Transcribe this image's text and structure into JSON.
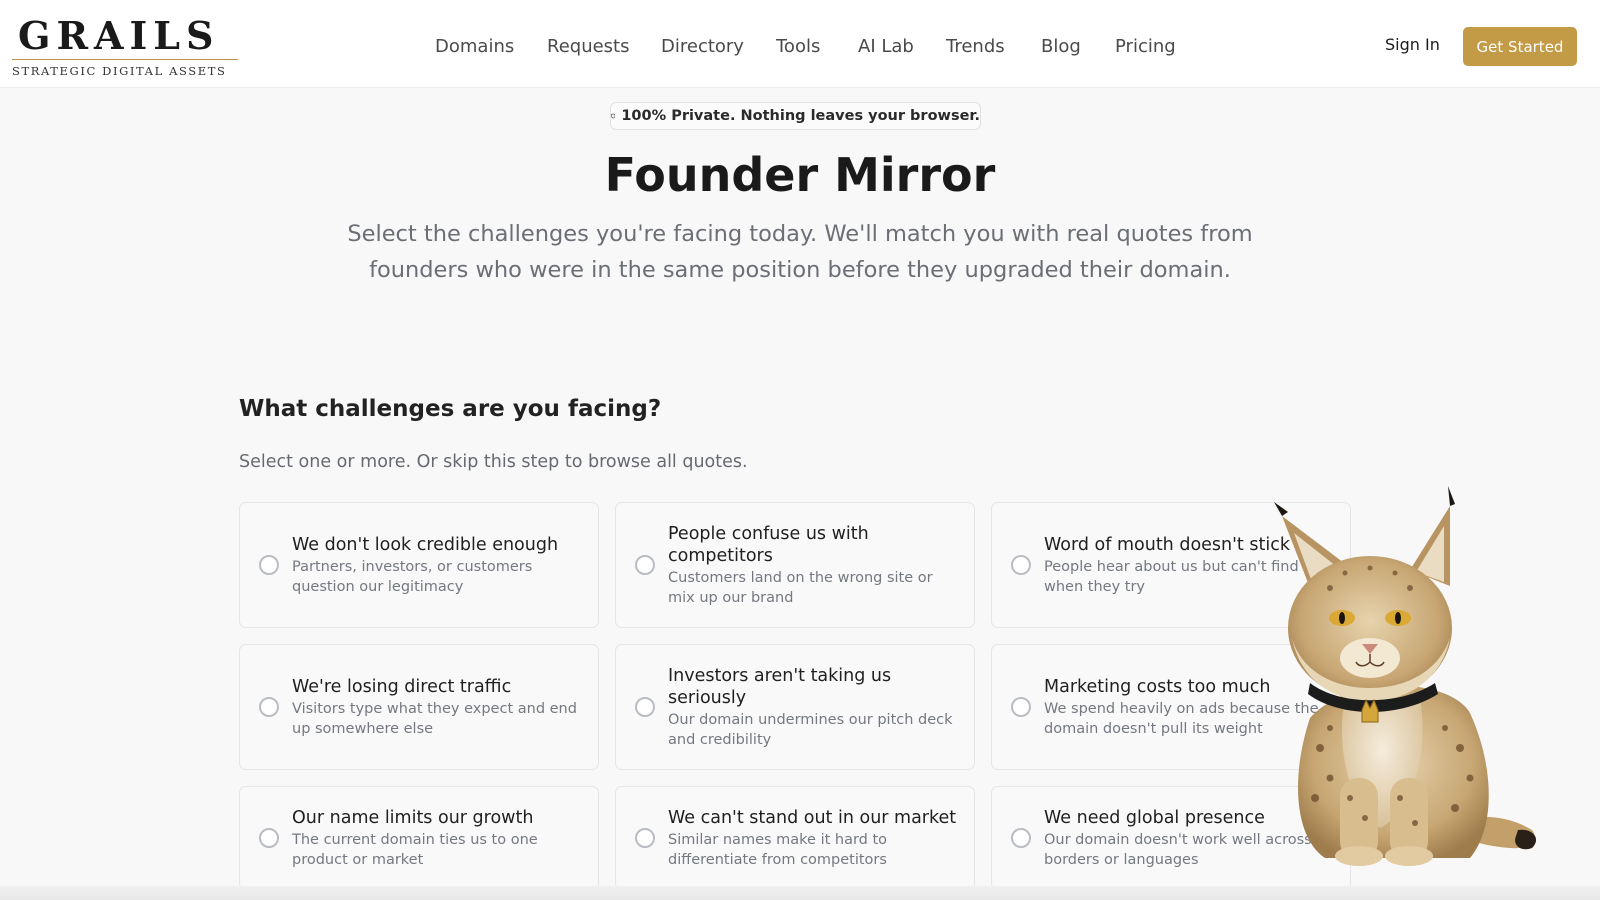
{
  "brand": {
    "name": "GRAILS",
    "tagline": "STRATEGIC DIGITAL ASSETS",
    "accent_color": "#c39a45"
  },
  "nav": {
    "items": [
      "Domains",
      "Requests",
      "Directory",
      "Tools",
      "AI Lab",
      "Trends",
      "Blog",
      "Pricing"
    ]
  },
  "auth": {
    "sign_in": "Sign In",
    "get_started": "Get Started"
  },
  "privacy_badge": {
    "icon": "shield-icon",
    "text": "100% Private. Nothing leaves your browser."
  },
  "hero": {
    "title": "Founder Mirror",
    "subtitle": "Select the challenges you're facing today. We'll match you with real quotes from founders who were in the same position before they upgraded their domain."
  },
  "challenges": {
    "heading": "What challenges are you facing?",
    "instructions": "Select one or more. Or skip this step to browse all quotes.",
    "options": [
      {
        "title": "We don't look credible enough",
        "desc": "Partners, investors, or customers question our legitimacy"
      },
      {
        "title": "People confuse us with competitors",
        "desc": "Customers land on the wrong site or mix up our brand"
      },
      {
        "title": "Word of mouth doesn't stick",
        "desc": "People hear about us but can't find us when they try"
      },
      {
        "title": "We're losing direct traffic",
        "desc": "Visitors type what they expect and end up somewhere else"
      },
      {
        "title": "Investors aren't taking us seriously",
        "desc": "Our domain undermines our pitch deck and credibility"
      },
      {
        "title": "Marketing costs too much",
        "desc": "We spend heavily on ads because the domain doesn't pull its weight"
      },
      {
        "title": "Our name limits our growth",
        "desc": "The current domain ties us to one product or market"
      },
      {
        "title": "We can't stand out in our market",
        "desc": "Similar names make it hard to differentiate from competitors"
      },
      {
        "title": "We need global presence",
        "desc": "Our domain doesn't work well across borders or languages"
      }
    ]
  },
  "mascot": {
    "icon": "lynx-mascot"
  }
}
